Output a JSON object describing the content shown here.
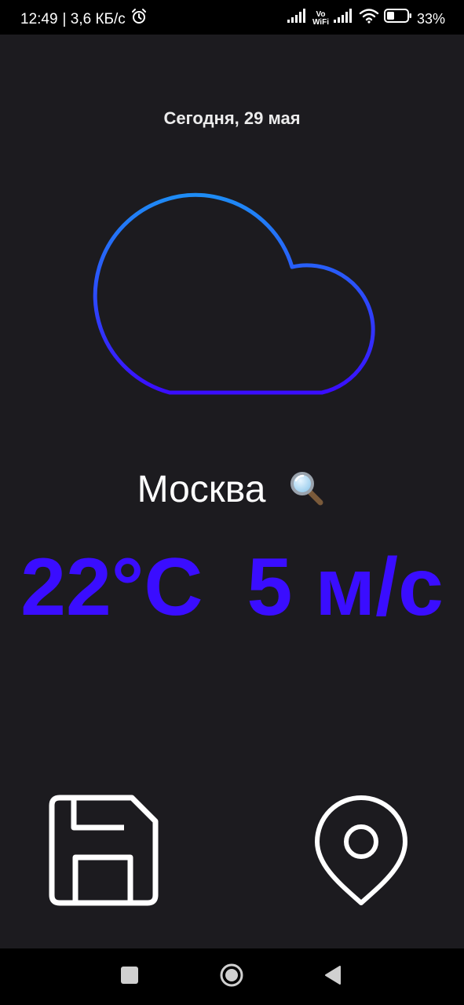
{
  "status_bar": {
    "time": "12:49",
    "network_speed": "| 3,6 КБ/с",
    "vowifi_top": "Vo",
    "vowifi_bottom": "WiFi",
    "battery": "33%",
    "icons": [
      "alarm-icon",
      "signal-icon",
      "vowifi-icon",
      "signal-icon",
      "wifi-icon",
      "battery-icon"
    ]
  },
  "weather": {
    "date": "Сегодня, 29 мая",
    "city": "Москва",
    "temperature": "22°C",
    "wind": "5 м/с",
    "condition_icon": "cloud-icon"
  },
  "colors": {
    "background": "#1c1b1f",
    "accent": "#3a0dff",
    "cloud_gradient_top": "#1e8cf5",
    "cloud_gradient_bottom": "#3a0dff"
  },
  "actions": {
    "search_icon": "search-icon",
    "save_icon": "save-icon",
    "location_icon": "location-pin-icon"
  },
  "nav_bar": {
    "buttons": [
      "recents-button",
      "home-button",
      "back-button"
    ]
  }
}
